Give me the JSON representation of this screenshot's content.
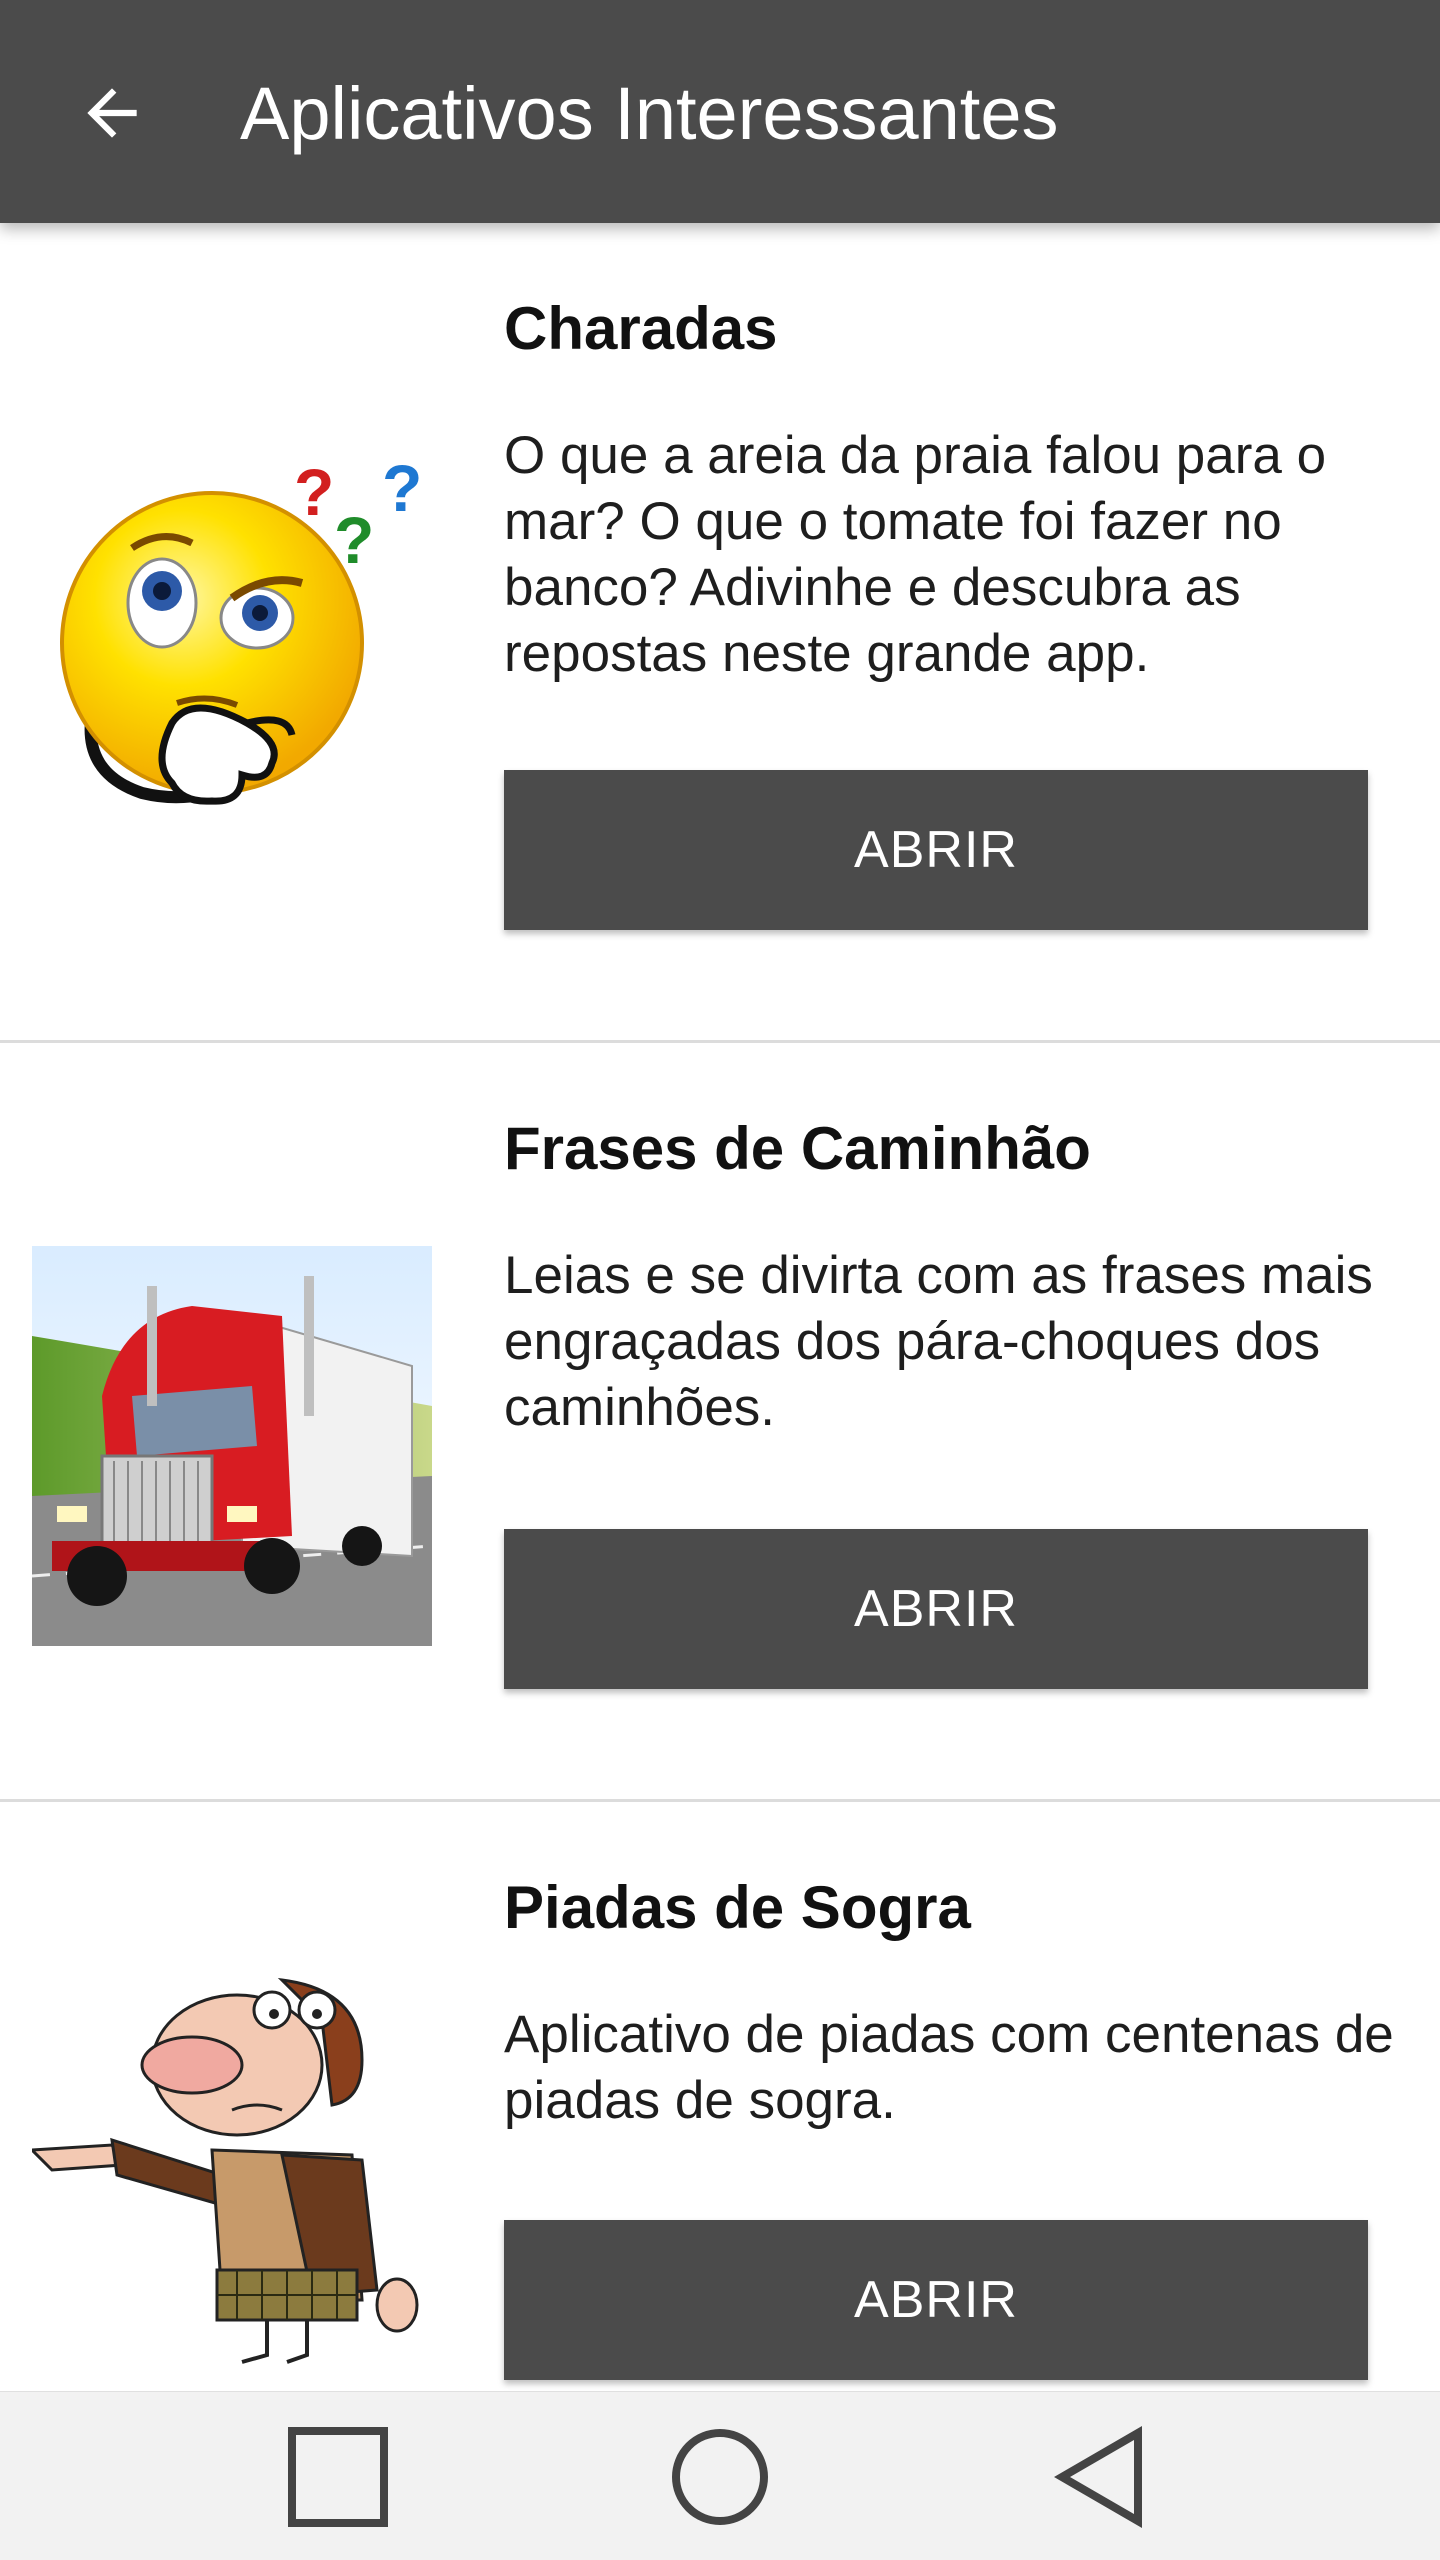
{
  "appbar": {
    "title": "Aplicativos Interessantes",
    "back_icon": "arrow-left-icon",
    "background": "#4b4b4b"
  },
  "items": [
    {
      "title": "Charadas",
      "description": "O que a areia da praia falou para o mar? O que o tomate foi fazer no banco? Adivinhe e descubra as repostas neste grande app.",
      "button_label": "ABRIR",
      "image": "thinking-smiley-icon"
    },
    {
      "title": "Frases de Caminhão",
      "description": "Leias e se divirta com as frases mais engraçadas dos pára-choques dos caminhões.",
      "button_label": "ABRIR",
      "image": "red-truck-photo"
    },
    {
      "title": "Piadas de Sogra",
      "description": "Aplicativo de piadas com centenas de piadas de sogra.",
      "button_label": "ABRIR",
      "image": "mother-in-law-cartoon"
    }
  ],
  "navbar": {
    "recents_icon": "square-icon",
    "home_icon": "circle-icon",
    "back_icon": "triangle-back-icon"
  },
  "colors": {
    "primary": "#4b4b4b",
    "button_text": "#ffffff",
    "divider": "#dcdcdc"
  }
}
